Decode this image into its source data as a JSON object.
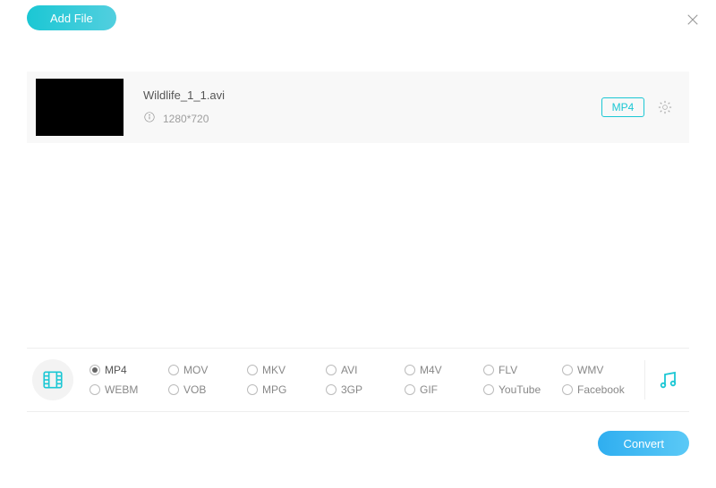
{
  "header": {
    "add_file_label": "Add File"
  },
  "file": {
    "name": "Wildlife_1_1.avi",
    "resolution": "1280*720",
    "output_format": "MP4"
  },
  "formats": {
    "selected": "MP4",
    "options": [
      "MP4",
      "MOV",
      "MKV",
      "AVI",
      "M4V",
      "FLV",
      "WMV",
      "WEBM",
      "VOB",
      "MPG",
      "3GP",
      "GIF",
      "YouTube",
      "Facebook"
    ]
  },
  "footer": {
    "convert_label": "Convert"
  }
}
